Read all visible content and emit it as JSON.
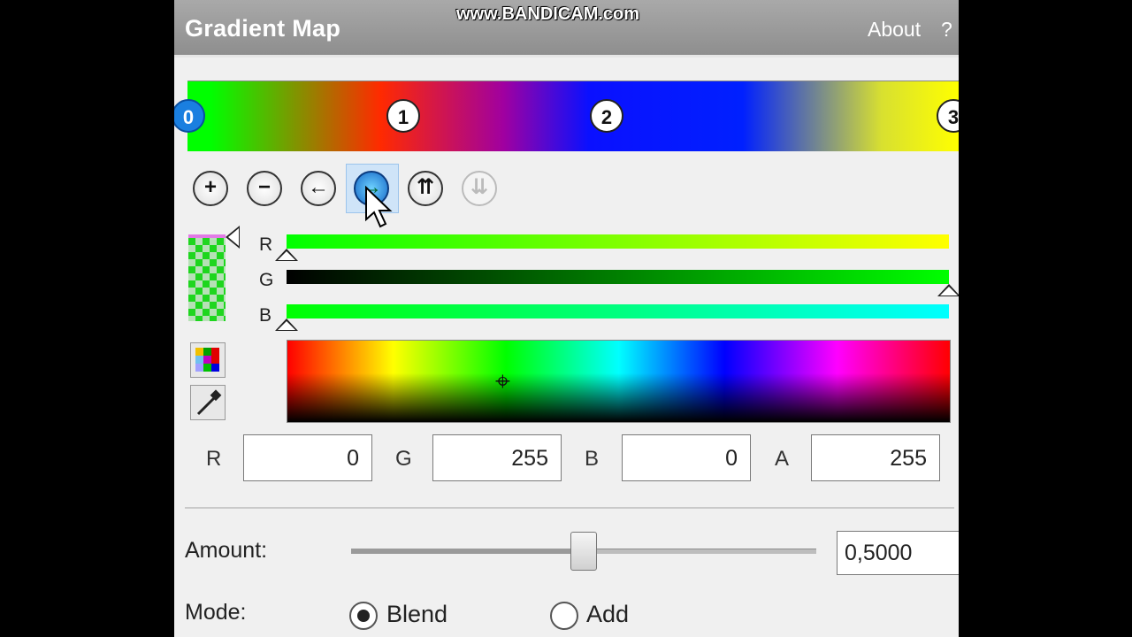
{
  "watermark": "www.BANDICAM.com",
  "header": {
    "title": "Gradient Map",
    "about": "About",
    "help": "?"
  },
  "gradient": {
    "stops": [
      {
        "label": "0"
      },
      {
        "label": "1"
      },
      {
        "label": "2"
      },
      {
        "label": "3"
      }
    ]
  },
  "toolbar": {
    "buttons": [
      {
        "name": "add-stop-button",
        "glyph": "+"
      },
      {
        "name": "remove-stop-button",
        "glyph": "−"
      },
      {
        "name": "move-left-button",
        "glyph": "←"
      },
      {
        "name": "move-right-button",
        "glyph": "→"
      },
      {
        "name": "distribute-button",
        "glyph": "⇈"
      },
      {
        "name": "distribute-disabled-button",
        "glyph": "⇊"
      }
    ]
  },
  "channels": [
    {
      "label": "R",
      "slider_value": 0
    },
    {
      "label": "G",
      "slider_value": 255
    },
    {
      "label": "B",
      "slider_value": 0
    }
  ],
  "values": {
    "r_label": "R",
    "r": "0",
    "g_label": "G",
    "g": "255",
    "b_label": "B",
    "b": "0",
    "a_label": "A",
    "a": "255"
  },
  "amount": {
    "label": "Amount:",
    "value": "0,5000",
    "fraction": 0.5
  },
  "mode": {
    "label": "Mode:",
    "options": [
      "Blend",
      "Add"
    ],
    "selected": "Blend"
  }
}
